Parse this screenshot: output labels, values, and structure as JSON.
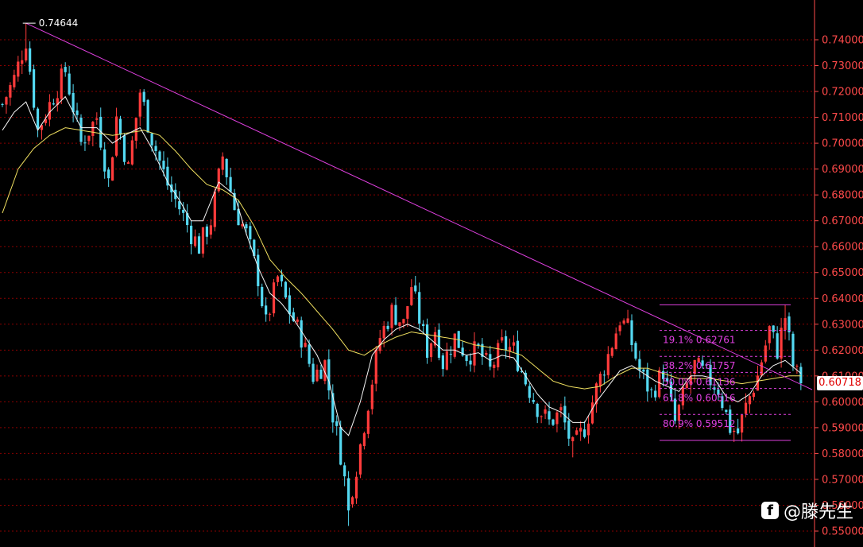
{
  "chart_data": {
    "type": "candlestick",
    "y_axis": {
      "min": 0.545,
      "max": 0.752,
      "ticks": [
        "0.74000",
        "0.73000",
        "0.72000",
        "0.71000",
        "0.70000",
        "0.69000",
        "0.68000",
        "0.67000",
        "0.66000",
        "0.65000",
        "0.64000",
        "0.63000",
        "0.62000",
        "0.61000",
        "0.60000",
        "0.59000",
        "0.58000",
        "0.57000",
        "0.56000",
        "0.55000"
      ],
      "position": "right",
      "grid": true
    },
    "current_price": "0.60718",
    "high_label": "0.74644",
    "trendline": {
      "from": 0.7464,
      "to": 0.6047
    },
    "fib_levels": [
      {
        "label": "19.1% 0.62761",
        "value": 0.62761
      },
      {
        "label": "38.2% 0.61757",
        "value": 0.61757
      },
      {
        "label": "50.0% 0.61136",
        "value": 0.61136
      },
      {
        "label": "61.8% 0.60516",
        "value": 0.60516
      },
      {
        "label": "80.9% 0.59512",
        "value": 0.59512
      }
    ],
    "fib_range": {
      "high": 0.6375,
      "low": 0.5851
    },
    "anchors": [
      [
        0,
        0.715
      ],
      [
        3,
        0.725
      ],
      [
        6,
        0.74
      ],
      [
        9,
        0.705
      ],
      [
        12,
        0.715
      ],
      [
        16,
        0.728
      ],
      [
        20,
        0.7
      ],
      [
        24,
        0.71
      ],
      [
        27,
        0.685
      ],
      [
        29,
        0.71
      ],
      [
        32,
        0.69
      ],
      [
        35,
        0.72
      ],
      [
        38,
        0.702
      ],
      [
        42,
        0.684
      ],
      [
        45,
        0.675
      ],
      [
        48,
        0.665
      ],
      [
        50,
        0.66
      ],
      [
        53,
        0.67
      ],
      [
        56,
        0.695
      ],
      [
        59,
        0.675
      ],
      [
        62,
        0.665
      ],
      [
        65,
        0.648
      ],
      [
        67,
        0.63
      ],
      [
        70,
        0.648
      ],
      [
        73,
        0.635
      ],
      [
        76,
        0.625
      ],
      [
        79,
        0.61
      ],
      [
        82,
        0.615
      ],
      [
        84,
        0.595
      ],
      [
        86,
        0.58
      ],
      [
        88,
        0.56
      ],
      [
        90,
        0.575
      ],
      [
        93,
        0.6
      ],
      [
        96,
        0.625
      ],
      [
        99,
        0.635
      ],
      [
        102,
        0.63
      ],
      [
        104,
        0.645
      ],
      [
        106,
        0.632
      ],
      [
        108,
        0.62
      ],
      [
        110,
        0.628
      ],
      [
        112,
        0.615
      ],
      [
        115,
        0.625
      ],
      [
        118,
        0.618
      ],
      [
        121,
        0.62
      ],
      [
        124,
        0.612
      ],
      [
        127,
        0.622
      ],
      [
        130,
        0.62
      ],
      [
        133,
        0.608
      ],
      [
        136,
        0.598
      ],
      [
        139,
        0.592
      ],
      [
        142,
        0.596
      ],
      [
        145,
        0.582
      ],
      [
        148,
        0.59
      ],
      [
        151,
        0.605
      ],
      [
        154,
        0.618
      ],
      [
        157,
        0.632
      ],
      [
        159,
        0.628
      ],
      [
        162,
        0.612
      ],
      [
        165,
        0.603
      ],
      [
        168,
        0.612
      ],
      [
        171,
        0.592
      ],
      [
        173,
        0.602
      ],
      [
        176,
        0.614
      ],
      [
        179,
        0.61
      ],
      [
        182,
        0.605
      ],
      [
        185,
        0.59
      ],
      [
        187,
        0.588
      ],
      [
        189,
        0.598
      ],
      [
        192,
        0.61
      ],
      [
        195,
        0.628
      ],
      [
        197,
        0.62
      ],
      [
        199,
        0.633
      ],
      [
        201,
        0.614
      ],
      [
        203,
        0.607
      ]
    ],
    "ma_short_anchors": [
      [
        0,
        0.705
      ],
      [
        3,
        0.712
      ],
      [
        6,
        0.716
      ],
      [
        9,
        0.705
      ],
      [
        12,
        0.712
      ],
      [
        16,
        0.718
      ],
      [
        20,
        0.706
      ],
      [
        24,
        0.706
      ],
      [
        28,
        0.7
      ],
      [
        31,
        0.703
      ],
      [
        35,
        0.706
      ],
      [
        38,
        0.698
      ],
      [
        42,
        0.685
      ],
      [
        45,
        0.678
      ],
      [
        48,
        0.67
      ],
      [
        51,
        0.67
      ],
      [
        55,
        0.685
      ],
      [
        59,
        0.68
      ],
      [
        62,
        0.665
      ],
      [
        65,
        0.652
      ],
      [
        68,
        0.642
      ],
      [
        71,
        0.638
      ],
      [
        74,
        0.632
      ],
      [
        77,
        0.625
      ],
      [
        80,
        0.618
      ],
      [
        83,
        0.608
      ],
      [
        86,
        0.59
      ],
      [
        88,
        0.587
      ],
      [
        91,
        0.6
      ],
      [
        94,
        0.618
      ],
      [
        97,
        0.624
      ],
      [
        100,
        0.628
      ],
      [
        103,
        0.63
      ],
      [
        106,
        0.628
      ],
      [
        109,
        0.624
      ],
      [
        112,
        0.62
      ],
      [
        115,
        0.62
      ],
      [
        118,
        0.618
      ],
      [
        121,
        0.619
      ],
      [
        124,
        0.616
      ],
      [
        127,
        0.618
      ],
      [
        130,
        0.617
      ],
      [
        133,
        0.61
      ],
      [
        136,
        0.603
      ],
      [
        139,
        0.598
      ],
      [
        142,
        0.596
      ],
      [
        145,
        0.592
      ],
      [
        148,
        0.592
      ],
      [
        151,
        0.6
      ],
      [
        154,
        0.606
      ],
      [
        157,
        0.612
      ],
      [
        160,
        0.614
      ],
      [
        163,
        0.611
      ],
      [
        166,
        0.608
      ],
      [
        169,
        0.606
      ],
      [
        172,
        0.604
      ],
      [
        175,
        0.61
      ],
      [
        178,
        0.61
      ],
      [
        181,
        0.609
      ],
      [
        184,
        0.602
      ],
      [
        187,
        0.6
      ],
      [
        190,
        0.603
      ],
      [
        193,
        0.61
      ],
      [
        196,
        0.614
      ],
      [
        199,
        0.616
      ],
      [
        203,
        0.611
      ]
    ],
    "ma_long_anchors": [
      [
        0,
        0.673
      ],
      [
        4,
        0.69
      ],
      [
        8,
        0.698
      ],
      [
        12,
        0.703
      ],
      [
        16,
        0.706
      ],
      [
        20,
        0.705
      ],
      [
        24,
        0.704
      ],
      [
        28,
        0.703
      ],
      [
        32,
        0.704
      ],
      [
        36,
        0.705
      ],
      [
        40,
        0.703
      ],
      [
        44,
        0.697
      ],
      [
        48,
        0.69
      ],
      [
        52,
        0.684
      ],
      [
        56,
        0.682
      ],
      [
        60,
        0.678
      ],
      [
        64,
        0.668
      ],
      [
        68,
        0.655
      ],
      [
        72,
        0.648
      ],
      [
        76,
        0.642
      ],
      [
        80,
        0.635
      ],
      [
        84,
        0.628
      ],
      [
        88,
        0.62
      ],
      [
        92,
        0.618
      ],
      [
        96,
        0.622
      ],
      [
        100,
        0.625
      ],
      [
        104,
        0.627
      ],
      [
        108,
        0.626
      ],
      [
        112,
        0.625
      ],
      [
        116,
        0.624
      ],
      [
        120,
        0.622
      ],
      [
        124,
        0.621
      ],
      [
        128,
        0.62
      ],
      [
        132,
        0.618
      ],
      [
        136,
        0.613
      ],
      [
        140,
        0.608
      ],
      [
        144,
        0.606
      ],
      [
        148,
        0.605
      ],
      [
        152,
        0.606
      ],
      [
        156,
        0.61
      ],
      [
        160,
        0.613
      ],
      [
        164,
        0.613
      ],
      [
        168,
        0.611
      ],
      [
        172,
        0.609
      ],
      [
        176,
        0.609
      ],
      [
        180,
        0.609
      ],
      [
        184,
        0.608
      ],
      [
        188,
        0.607
      ],
      [
        192,
        0.608
      ],
      [
        196,
        0.609
      ],
      [
        200,
        0.61
      ],
      [
        203,
        0.61
      ]
    ],
    "colors": {
      "up": "#ff3b3b",
      "down": "#54d9f2",
      "grid": "#8a0000",
      "axis": "#ff4a4a",
      "trendline": "#e040e0",
      "fib": "#e040e0",
      "ma_short": "#f5f5f5",
      "ma_long": "#f0e060"
    }
  },
  "watermark": {
    "logo_glyph": "f",
    "text": "@滕先生"
  }
}
